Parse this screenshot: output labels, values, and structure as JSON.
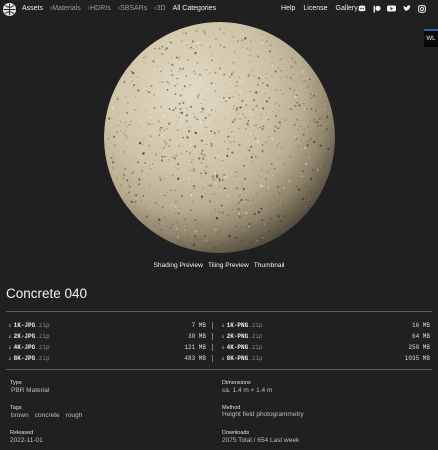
{
  "nav": {
    "assets": "Assets",
    "materials": "›Materials",
    "hdris": "›HDRIs",
    "sbsars": "›SBSARs",
    "threed": "›3D",
    "all_categories": "All Categories",
    "help": "Help",
    "license": "License",
    "gallery": "Gallery",
    "social_icons": [
      "discord-icon",
      "patreon-icon",
      "youtube-icon",
      "twitter-icon",
      "instagram-icon"
    ]
  },
  "side_tab": {
    "label": "WL"
  },
  "preview_tabs": [
    "Shading Preview",
    "Tiling Preview",
    "Thumbnail"
  ],
  "title": "Concrete 040",
  "downloads": [
    {
      "res": "1K-JPG",
      "ext": ".zip",
      "size": "7 MB"
    },
    {
      "res": "1K-PNG",
      "ext": ".zip",
      "size": "16 MB"
    },
    {
      "res": "2K-JPG",
      "ext": ".zip",
      "size": "30 MB"
    },
    {
      "res": "2K-PNG",
      "ext": ".zip",
      "size": "64 MB"
    },
    {
      "res": "4K-JPG",
      "ext": ".zip",
      "size": "121 MB"
    },
    {
      "res": "4K-PNG",
      "ext": ".zip",
      "size": "258 MB"
    },
    {
      "res": "8K-JPG",
      "ext": ".zip",
      "size": "483 MB"
    },
    {
      "res": "8K-PNG",
      "ext": ".zip",
      "size": "1035 MB"
    }
  ],
  "details": {
    "type_label": "Type",
    "type_value": "PBR Material",
    "dimensions_label": "Dimensions",
    "dimensions_value": "ca. 1.4 m × 1.4 m",
    "tags_label": "Tags",
    "tags": [
      "brown",
      "concrete",
      "rough"
    ],
    "method_label": "Method",
    "method_value": "Height field photogrammetry",
    "released_label": "Released",
    "released_value": "2022-11-01",
    "downloads_label": "Downloads",
    "downloads_value": "2075 Total / 654 Last week"
  },
  "colors": {
    "background": "#202020",
    "concrete": "#cfc6ac",
    "side_tab_accent": "#2f5fb0"
  }
}
